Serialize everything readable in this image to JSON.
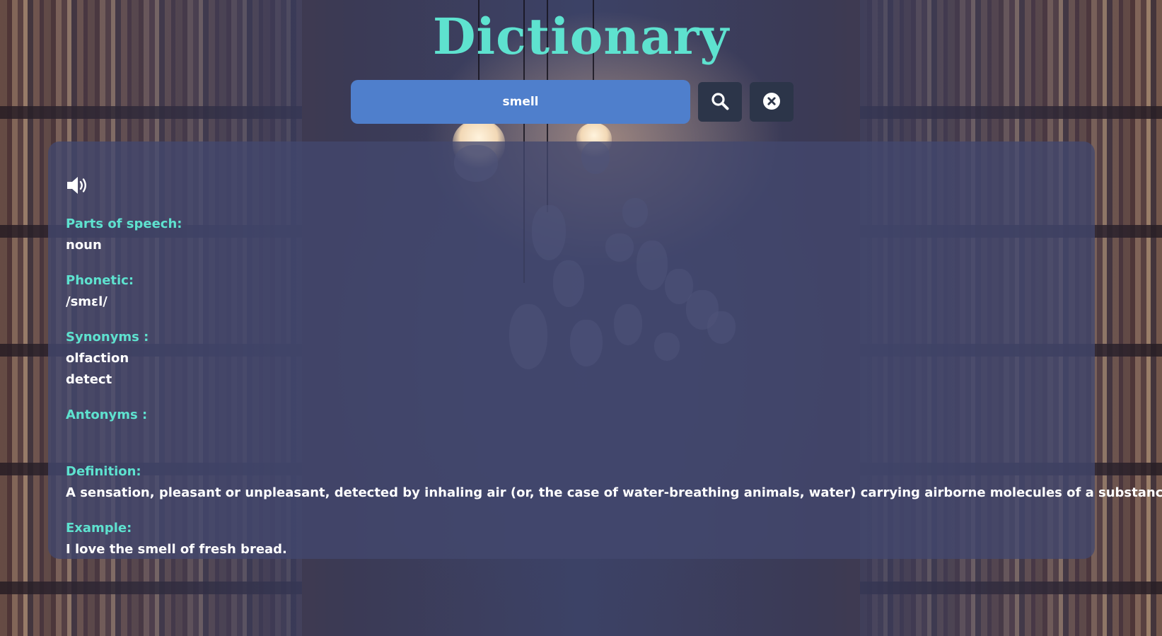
{
  "app": {
    "title": "Dictionary"
  },
  "search": {
    "value": "smell",
    "search_icon": "search-icon",
    "clear_icon": "close-circle-icon"
  },
  "result": {
    "audio_icon": "speaker-icon",
    "parts_of_speech_label": "Parts of speech:",
    "parts_of_speech": "noun",
    "phonetic_label": "Phonetic:",
    "phonetic": "/smɛl/",
    "synonyms_label": "Synonyms :",
    "synonyms": [
      "olfaction",
      "detect"
    ],
    "antonyms_label": "Antonyms :",
    "antonyms": [],
    "definition_label": "Definition:",
    "definition": "A sensation, pleasant or unpleasant, detected by inhaling air (or, the case of water-breathing animals, water) carrying airborne molecules of a substance.",
    "example_label": "Example:",
    "example": "I love the smell of fresh bread."
  },
  "colors": {
    "title": "#5ee2cf",
    "label": "#5ee2cf",
    "search_bg": "#4f7fcc",
    "button_bg": "#2c3549",
    "card_bg": "rgba(66,72,110,0.78)"
  }
}
